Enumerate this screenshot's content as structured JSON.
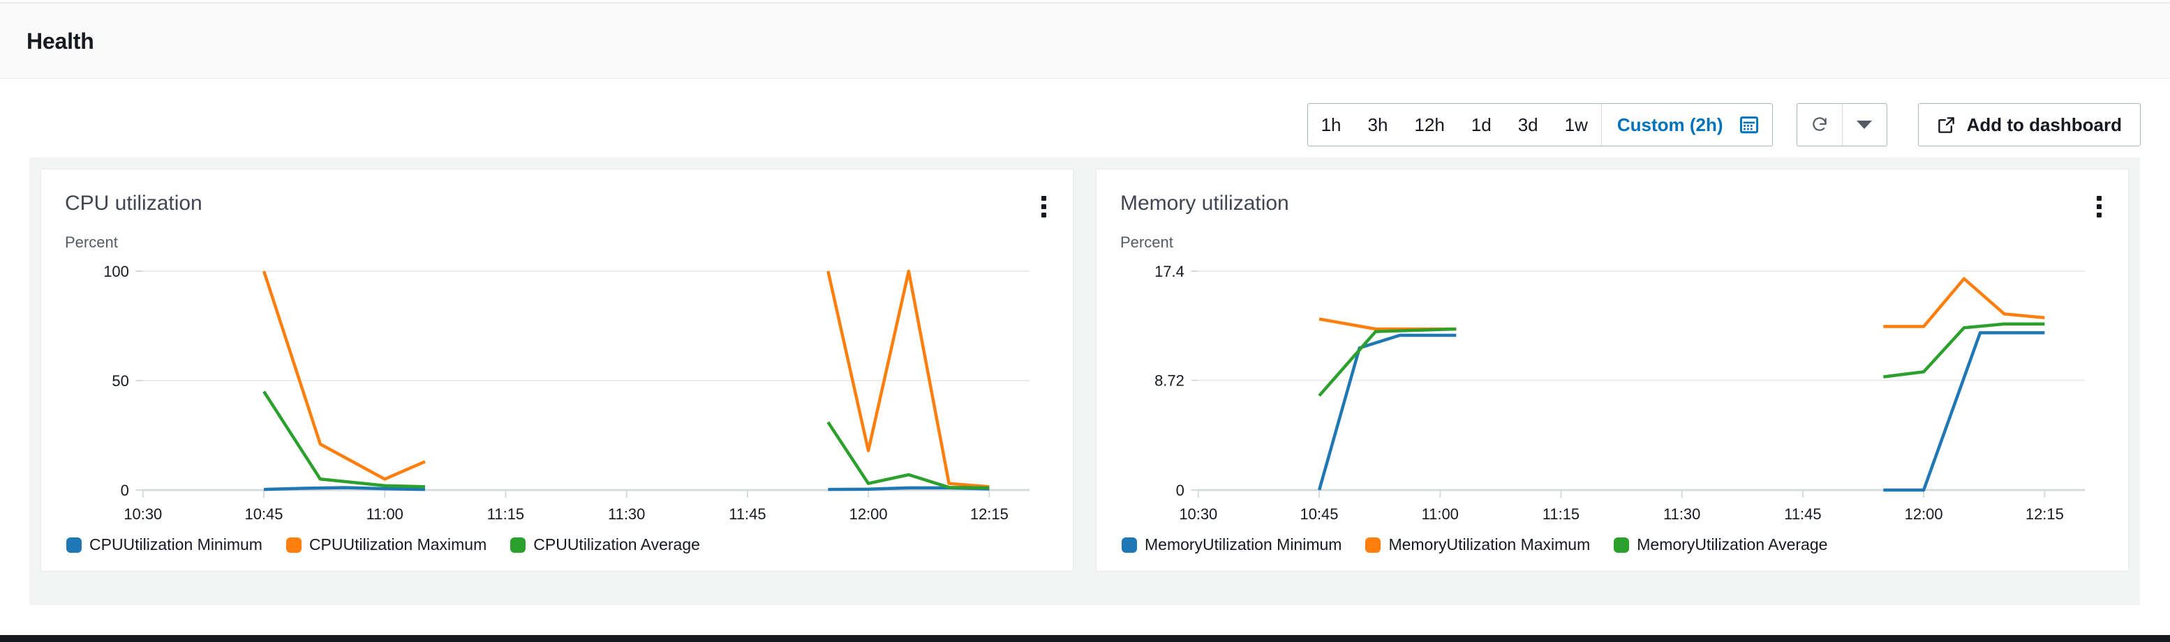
{
  "header": {
    "title": "Health"
  },
  "toolbar": {
    "ranges": [
      {
        "label": "1h",
        "active": false
      },
      {
        "label": "3h",
        "active": false
      },
      {
        "label": "12h",
        "active": false
      },
      {
        "label": "1d",
        "active": false
      },
      {
        "label": "3d",
        "active": false
      },
      {
        "label": "1w",
        "active": false
      },
      {
        "label": "Custom (2h)",
        "active": true
      }
    ],
    "calendar_icon": "calendar-icon",
    "refresh_icon": "refresh-icon",
    "refresh_dropdown_icon": "chevron-down-icon",
    "add_to_dashboard_label": "Add to dashboard",
    "add_to_dashboard_icon": "external-link-icon",
    "accent_color": "#0073bb"
  },
  "colors": {
    "minimum": "#1f77b4",
    "maximum": "#ff7f0e",
    "average": "#2ca02c",
    "grid": "#eaeded",
    "axis": "#d5dbdb",
    "card_bg": "#ffffff",
    "panel_bg": "#f2f3f3"
  },
  "charts": [
    {
      "title": "CPU utilization",
      "menu_icon": "kebab-menu-icon",
      "unit": "Percent",
      "legend": [
        {
          "label": "CPUUtilization Minimum",
          "color": "#1f77b4"
        },
        {
          "label": "CPUUtilization Maximum",
          "color": "#ff7f0e"
        },
        {
          "label": "CPUUtilization Average",
          "color": "#2ca02c"
        }
      ]
    },
    {
      "title": "Memory utilization",
      "menu_icon": "kebab-menu-icon",
      "unit": "Percent",
      "legend": [
        {
          "label": "MemoryUtilization Minimum",
          "color": "#1f77b4"
        },
        {
          "label": "MemoryUtilization Maximum",
          "color": "#ff7f0e"
        },
        {
          "label": "MemoryUtilization Average",
          "color": "#2ca02c"
        }
      ]
    }
  ],
  "chart_data": [
    {
      "type": "line",
      "title": "CPU utilization",
      "ylabel": "Percent",
      "xlabel": "",
      "grid": true,
      "legend_position": "bottom-left",
      "yticks": [
        0,
        50,
        100
      ],
      "ylim": [
        0,
        100
      ],
      "xticks": [
        "10:30",
        "10:45",
        "11:00",
        "11:15",
        "11:30",
        "11:45",
        "12:00",
        "12:15"
      ],
      "xlim": [
        "10:30",
        "12:20"
      ],
      "series": [
        {
          "name": "CPUUtilization Minimum",
          "color": "#1f77b4",
          "segments": [
            {
              "x": [
                "10:45",
                "10:50",
                "10:55",
                "11:00",
                "11:05"
              ],
              "y": [
                0.3,
                0.8,
                1.1,
                0.6,
                0.3
              ]
            },
            {
              "x": [
                "11:55",
                "12:00",
                "12:05",
                "12:10",
                "12:15"
              ],
              "y": [
                0.3,
                0.4,
                1.0,
                1.0,
                0.5
              ]
            }
          ]
        },
        {
          "name": "CPUUtilization Maximum",
          "color": "#ff7f0e",
          "segments": [
            {
              "x": [
                "10:45",
                "10:52",
                "11:00",
                "11:05"
              ],
              "y": [
                100,
                21,
                5,
                13
              ]
            },
            {
              "x": [
                "11:55",
                "12:00",
                "12:05",
                "12:10",
                "12:15"
              ],
              "y": [
                100,
                18,
                100,
                3,
                1.5
              ]
            }
          ]
        },
        {
          "name": "CPUUtilization Average",
          "color": "#2ca02c",
          "segments": [
            {
              "x": [
                "10:45",
                "10:52",
                "11:00",
                "11:05"
              ],
              "y": [
                45,
                5,
                2,
                1.5
              ]
            },
            {
              "x": [
                "11:55",
                "12:00",
                "12:05",
                "12:10",
                "12:15"
              ],
              "y": [
                31,
                3,
                7,
                1.2,
                1.0
              ]
            }
          ]
        }
      ]
    },
    {
      "type": "line",
      "title": "Memory utilization",
      "ylabel": "Percent",
      "xlabel": "",
      "grid": true,
      "legend_position": "bottom-left",
      "yticks": [
        0,
        8.72,
        17.4
      ],
      "ylim": [
        0,
        17.4
      ],
      "xticks": [
        "10:30",
        "10:45",
        "11:00",
        "11:15",
        "11:30",
        "11:45",
        "12:00",
        "12:15"
      ],
      "xlim": [
        "10:30",
        "12:20"
      ],
      "series": [
        {
          "name": "MemoryUtilization Minimum",
          "color": "#1f77b4",
          "segments": [
            {
              "x": [
                "10:45",
                "10:50",
                "10:55",
                "11:02"
              ],
              "y": [
                0,
                11.3,
                12.3,
                12.3
              ]
            },
            {
              "x": [
                "11:55",
                "12:00",
                "12:07",
                "12:15"
              ],
              "y": [
                0,
                0,
                12.5,
                12.5
              ]
            }
          ]
        },
        {
          "name": "MemoryUtilization Maximum",
          "color": "#ff7f0e",
          "segments": [
            {
              "x": [
                "10:45",
                "10:52",
                "11:02"
              ],
              "y": [
                13.6,
                12.8,
                12.8
              ]
            },
            {
              "x": [
                "11:55",
                "12:00",
                "12:05",
                "12:10",
                "12:15"
              ],
              "y": [
                13.0,
                13.0,
                16.8,
                14.0,
                13.7
              ]
            }
          ]
        },
        {
          "name": "MemoryUtilization Average",
          "color": "#2ca02c",
          "segments": [
            {
              "x": [
                "10:45",
                "10:52",
                "11:02"
              ],
              "y": [
                7.5,
                12.6,
                12.8
              ]
            },
            {
              "x": [
                "11:55",
                "12:00",
                "12:05",
                "12:10",
                "12:15"
              ],
              "y": [
                9.0,
                9.4,
                12.9,
                13.2,
                13.2
              ]
            }
          ]
        }
      ]
    }
  ]
}
